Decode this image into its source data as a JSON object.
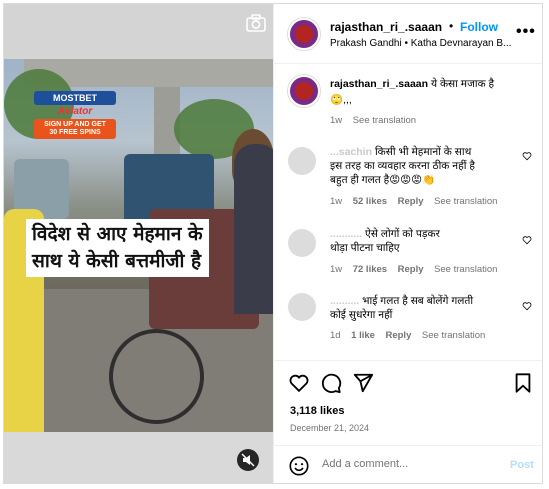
{
  "post": {
    "username": "rajasthan_ri_.saaan",
    "follow_label": "Follow",
    "separator": "•",
    "audio": "Prakash Gandhi • Katha Devnarayan B...",
    "video_caption_line1": "विदेश से आए मेहमान के",
    "video_caption_line2": "साथ ये केसी बत्तमीजी है",
    "ad_brand": "MOSTBET",
    "ad_sub": "Aviator",
    "ad_promo_line1": "SIGN UP AND GET",
    "ad_promo_line2": "30 FREE SPINS"
  },
  "caption": {
    "username": "rajasthan_ri_.saaan",
    "text": "ये केसा मजाक है",
    "line2": "🙄,,,",
    "time": "1w",
    "see_translation": "See translation"
  },
  "comments": [
    {
      "username": "...sachin",
      "text_line1": "किसी भी मेहमानों के साथ",
      "text_line2": "इस तरह का व्यवहार करना ठीक नहीं है",
      "text_line3": "बहुत ही गलत है😡😡😡👏",
      "time": "1w",
      "likes": "52 likes",
      "reply": "Reply",
      "see_translation": "See translation"
    },
    {
      "username": "...........",
      "text_line1": "ऐसे लोगों को पड़कर",
      "text_line2": "थोड़ा पीटना चाहिए",
      "time": "1w",
      "likes": "72 likes",
      "reply": "Reply",
      "see_translation": "See translation"
    },
    {
      "username": "..........",
      "text_line1": "भाई गलत है सब बोलेंगे गलती",
      "text_line2": "कोई सुधरेगा नहीं",
      "time": "1d",
      "likes": "1 like",
      "reply": "Reply",
      "see_translation": "See translation"
    }
  ],
  "stats": {
    "likes": "3,118 likes",
    "date": "December 21, 2024"
  },
  "composer": {
    "placeholder": "Add a comment...",
    "post_label": "Post"
  },
  "icons": {
    "more": "more-options-icon",
    "camera": "camera-icon",
    "mute": "muted-speaker-icon",
    "like": "heart-icon",
    "comment": "comment-icon",
    "share": "share-icon",
    "save": "bookmark-icon",
    "emoji": "emoji-icon"
  },
  "colors": {
    "follow": "#0095f6",
    "muted_text": "#737373",
    "post_disabled": "#b2dffc"
  }
}
